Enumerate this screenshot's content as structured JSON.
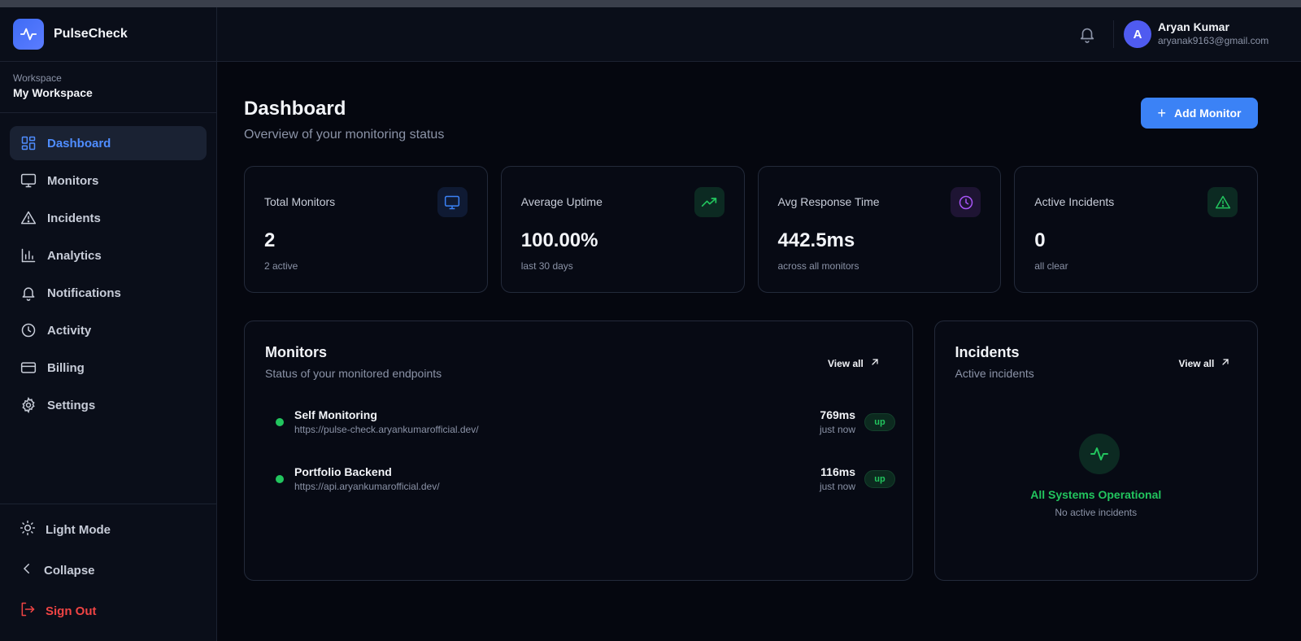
{
  "app": {
    "name": "PulseCheck"
  },
  "workspace": {
    "label": "Workspace",
    "name": "My Workspace"
  },
  "sidebar": {
    "items": [
      {
        "label": "Dashboard",
        "icon": "dashboard-icon",
        "active": true
      },
      {
        "label": "Monitors",
        "icon": "monitor-icon"
      },
      {
        "label": "Incidents",
        "icon": "warning-icon"
      },
      {
        "label": "Analytics",
        "icon": "bar-chart-icon"
      },
      {
        "label": "Notifications",
        "icon": "bell-icon"
      },
      {
        "label": "Activity",
        "icon": "clock-icon"
      },
      {
        "label": "Billing",
        "icon": "credit-card-icon"
      },
      {
        "label": "Settings",
        "icon": "gear-icon"
      }
    ],
    "bottom": {
      "light_mode": "Light Mode",
      "collapse": "Collapse",
      "sign_out": "Sign Out"
    }
  },
  "header": {
    "user": {
      "initial": "A",
      "name": "Aryan Kumar",
      "email": "aryanak9163@gmail.com"
    }
  },
  "page": {
    "title": "Dashboard",
    "subtitle": "Overview of your monitoring status",
    "add_button": "Add Monitor"
  },
  "stats": [
    {
      "label": "Total Monitors",
      "value": "2",
      "sub": "2 active",
      "icon": "monitor-icon",
      "color": "#3b82f6"
    },
    {
      "label": "Average Uptime",
      "value": "100.00%",
      "sub": "last 30 days",
      "icon": "trending-up-icon",
      "color": "#22c55e"
    },
    {
      "label": "Avg Response Time",
      "value": "442.5ms",
      "sub": "across all monitors",
      "icon": "clock-icon",
      "color": "#a855f7"
    },
    {
      "label": "Active Incidents",
      "value": "0",
      "sub": "all clear",
      "icon": "warning-icon",
      "color": "#22c55e"
    }
  ],
  "monitors_panel": {
    "title": "Monitors",
    "subtitle": "Status of your monitored endpoints",
    "view_all": "View all",
    "rows": [
      {
        "name": "Self Monitoring",
        "url": "https://pulse-check.aryankumarofficial.dev/",
        "response": "769ms",
        "when": "just now",
        "status": "up"
      },
      {
        "name": "Portfolio Backend",
        "url": "https://api.aryankumarofficial.dev/",
        "response": "116ms",
        "when": "just now",
        "status": "up"
      }
    ]
  },
  "incidents_panel": {
    "title": "Incidents",
    "subtitle": "Active incidents",
    "view_all": "View all",
    "empty_title": "All Systems Operational",
    "empty_sub": "No active incidents"
  },
  "colors": {
    "accent": "#3b82f6",
    "success": "#22c55e",
    "danger": "#ef4444",
    "purple": "#a855f7",
    "background": "#05070f"
  }
}
